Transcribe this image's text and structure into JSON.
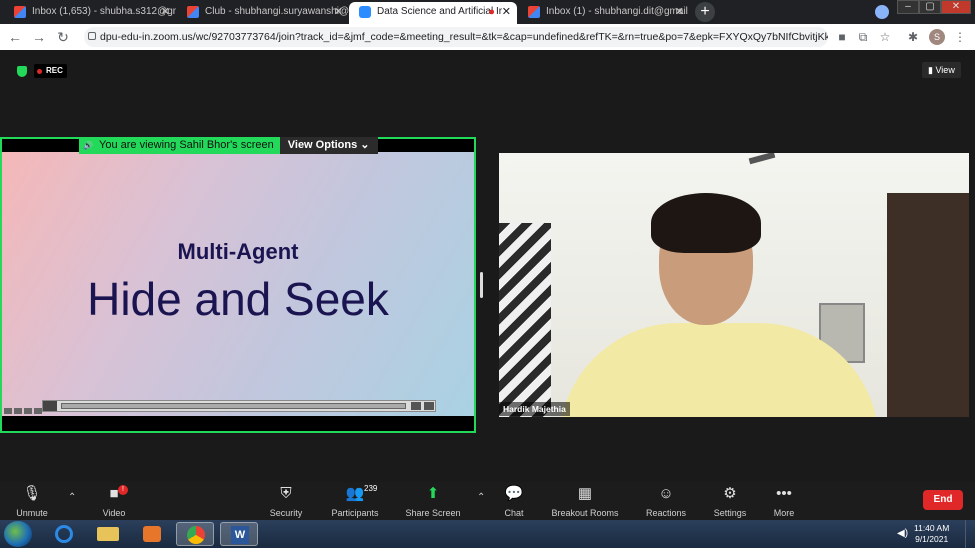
{
  "browser": {
    "tabs": [
      {
        "title": "Inbox (1,653) - shubha.s312@gm",
        "icon": "gmail-icon"
      },
      {
        "title": "Club - shubhangi.suryawanshi@d",
        "icon": "gmail-icon"
      },
      {
        "title": "Data Science and Artificial Ir",
        "icon": "zoom-icon",
        "active": true
      },
      {
        "title": "Inbox (1) - shubhangi.dit@gmail",
        "icon": "gmail-icon"
      }
    ],
    "new_tab": "+",
    "url": "dpu-edu-in.zoom.us/wc/92703773764/join?track_id=&jmf_code=&meeting_result=&tk=&cap=undefined&refTK=&rn=true&po=7&epk=FXYQxQy7bNIfCbvitjKk...",
    "profile_initial": "S"
  },
  "meeting": {
    "rec_label": "REC",
    "view_label": "View",
    "share_banner": "You are viewing Sahil Bhor's screen",
    "view_options": "View Options",
    "slide_subtitle": "Multi-Agent",
    "slide_title": "Hide and Seek",
    "participant_name": "Hardik Majethia"
  },
  "toolbar": {
    "unmute": "Unmute",
    "video": "Video",
    "video_badge": "!",
    "security": "Security",
    "participants": "Participants",
    "participants_count": "239",
    "share_screen": "Share Screen",
    "chat": "Chat",
    "breakout_rooms": "Breakout Rooms",
    "reactions": "Reactions",
    "settings": "Settings",
    "more": "More",
    "end": "End"
  },
  "taskbar": {
    "time": "11:40 AM",
    "date": "9/1/2021",
    "word_letter": "W"
  },
  "colors": {
    "zoom_green": "#23d959",
    "end_red": "#e02828",
    "slide_text": "#1a1450"
  }
}
